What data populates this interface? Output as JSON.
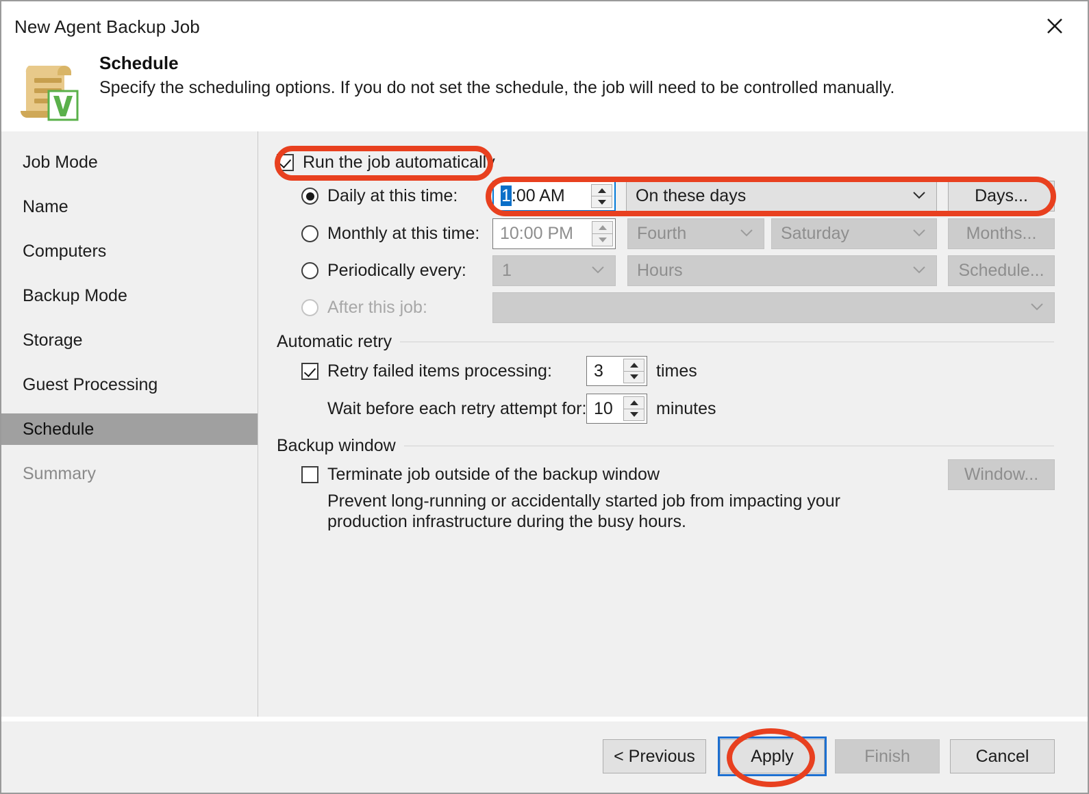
{
  "window": {
    "title": "New Agent Backup Job",
    "close_icon": "close-icon"
  },
  "header": {
    "icon": "scroll-veeam-icon",
    "title": "Schedule",
    "description": "Specify the scheduling options. If you do not set the schedule, the job will need to be controlled manually."
  },
  "sidebar": {
    "items": [
      {
        "label": "Job Mode",
        "state": "normal"
      },
      {
        "label": "Name",
        "state": "normal"
      },
      {
        "label": "Computers",
        "state": "normal"
      },
      {
        "label": "Backup Mode",
        "state": "normal"
      },
      {
        "label": "Storage",
        "state": "normal"
      },
      {
        "label": "Guest Processing",
        "state": "normal"
      },
      {
        "label": "Schedule",
        "state": "active"
      },
      {
        "label": "Summary",
        "state": "disabled"
      }
    ]
  },
  "schedule": {
    "run_automatically": {
      "label": "Run the job automatically",
      "checked": true
    },
    "rows": [
      {
        "radio_label": "Daily at this time:",
        "selected": true,
        "time_value": "1:00 AM",
        "time_selection": "1",
        "time_rest": ":00 AM",
        "combo_value": "On these days",
        "button_label": "Days..."
      },
      {
        "radio_label": "Monthly at this time:",
        "selected": false,
        "time_value": "10:00 PM",
        "combo_value": "Fourth",
        "combo2_value": "Saturday",
        "button_label": "Months..."
      },
      {
        "radio_label": "Periodically every:",
        "selected": false,
        "combo_value": "1",
        "combo2_value": "Hours",
        "button_label": "Schedule..."
      },
      {
        "radio_label": "After this job:",
        "selected": false,
        "combo_value": ""
      }
    ]
  },
  "automatic_retry": {
    "group_label": "Automatic retry",
    "retry_checkbox": {
      "label": "Retry failed items processing:",
      "checked": true
    },
    "retry_times_value": "3",
    "retry_times_unit": "times",
    "wait_label": "Wait before each retry attempt for:",
    "wait_value": "10",
    "wait_unit": "minutes"
  },
  "backup_window": {
    "group_label": "Backup window",
    "terminate_checkbox": {
      "label": "Terminate job outside of the backup window",
      "checked": false
    },
    "window_button": "Window...",
    "description": "Prevent long-running or accidentally started job from impacting your production infrastructure during the busy hours."
  },
  "footer": {
    "previous": "< Previous",
    "apply": "Apply",
    "finish": "Finish",
    "cancel": "Cancel"
  },
  "colors": {
    "annotation_red": "#e8401f",
    "focus_blue": "#1d6fd0",
    "selection_blue": "#0b6fc8",
    "active_nav": "#a0a0a0",
    "veeam_green": "#5ab04a"
  }
}
